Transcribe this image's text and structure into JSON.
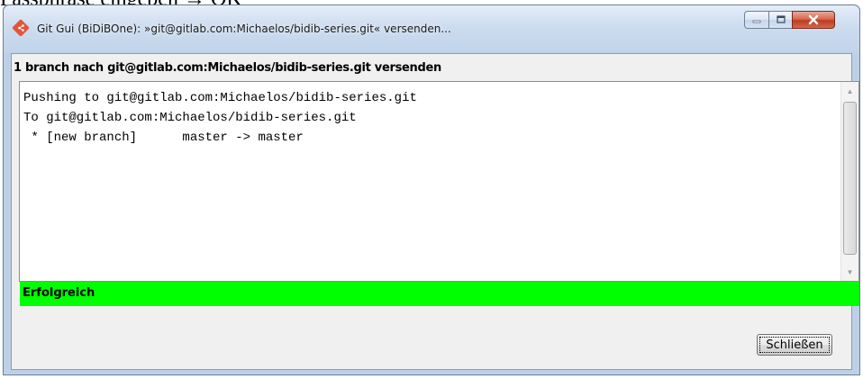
{
  "background_text": "Passphrase eingeben → OK",
  "window": {
    "title": "Git Gui (BiDiBOne): »git@gitlab.com:Michaelos/bidib-series.git« versenden...",
    "controls": [
      "minimize-icon",
      "maximize-icon",
      "close-icon"
    ]
  },
  "dialog": {
    "heading": "1 branch nach git@gitlab.com:Michaelos/bidib-series.git versenden",
    "output": {
      "lines": [
        "Pushing to git@gitlab.com:Michaelos/bidib-series.git",
        "To git@gitlab.com:Michaelos/bidib-series.git",
        " * [new branch]      master -> master"
      ]
    },
    "status": "Erfolgreich",
    "close_label": "Schließen"
  },
  "colors": {
    "success": "#00ff00",
    "close_button": "#c03a1f",
    "app_icon": "#e2553a"
  }
}
